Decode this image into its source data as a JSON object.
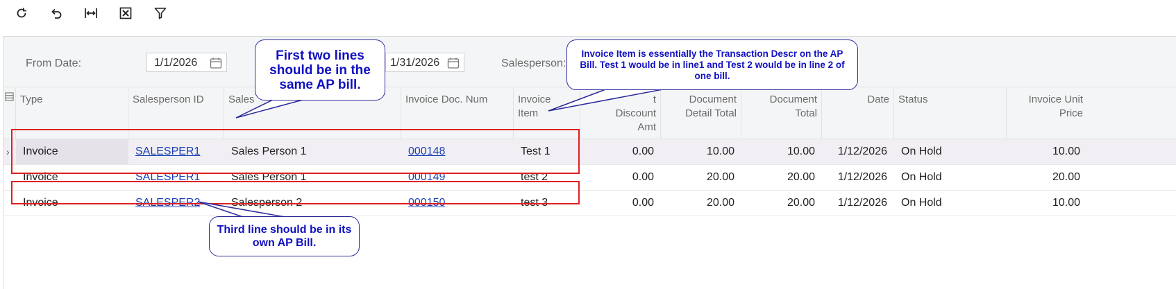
{
  "toolbar": {
    "buttons": [
      {
        "icon": "refresh-icon"
      },
      {
        "icon": "undo-icon"
      },
      {
        "icon": "fit-columns-icon"
      },
      {
        "icon": "excel-export-icon"
      },
      {
        "icon": "filter-icon"
      }
    ]
  },
  "filters": {
    "from_date_label": "From Date:",
    "from_date_value": "1/1/2026",
    "to_date_value": "1/31/2026",
    "salesperson_label": "Salesperson:"
  },
  "columns": {
    "type": "Type",
    "salesperson_id": "Salesperson ID",
    "salesperson_name": "Sales",
    "invoice_doc_num": "Invoice Doc. Num",
    "invoice_item_1": "Invoice",
    "invoice_item_2": "Item",
    "discount_1": "t",
    "discount_2": "Discount",
    "discount_3": "Amt",
    "doc_detail_total_1": "Document",
    "doc_detail_total_2": "Detail Total",
    "doc_total_1": "Document",
    "doc_total_2": "Total",
    "date": "Date",
    "status": "Status",
    "unit_price_1": "Invoice Unit",
    "unit_price_2": "Price"
  },
  "rows": [
    {
      "type": "Invoice",
      "salesperson_id": "SALESPER1",
      "salesperson_name": "Sales Person 1",
      "doc_num": "000148",
      "item": "Test 1",
      "discount": "0.00",
      "detail_total": "10.00",
      "doc_total": "10.00",
      "date": "1/12/2026",
      "status": "On Hold",
      "unit_price": "10.00"
    },
    {
      "type": "Invoice",
      "salesperson_id": "SALESPER1",
      "salesperson_name": "Sales Person 1",
      "doc_num": "000149",
      "item": "test 2",
      "discount": "0.00",
      "detail_total": "20.00",
      "doc_total": "20.00",
      "date": "1/12/2026",
      "status": "On Hold",
      "unit_price": "20.00"
    },
    {
      "type": "Invoice",
      "salesperson_id": "SALESPER2",
      "salesperson_name": "Salesperson 2",
      "doc_num": "000150",
      "item": "test 3",
      "discount": "0.00",
      "detail_total": "20.00",
      "doc_total": "20.00",
      "date": "1/12/2026",
      "status": "On Hold",
      "unit_price": "10.00"
    }
  ],
  "annotations": {
    "callout_1": "First two lines should be in the same AP bill.",
    "callout_2": "Invoice Item is essentially the Transaction Descr on the AP Bill. Test 1 would be in line1 and Test 2 would be in line 2 of one bill.",
    "callout_3": "Third line should be in its own AP Bill."
  },
  "colors": {
    "link": "#1a3fb5",
    "annotation_text": "#1010c0",
    "annotation_border": "#2b2b9b",
    "highlight_box": "#e02020"
  }
}
